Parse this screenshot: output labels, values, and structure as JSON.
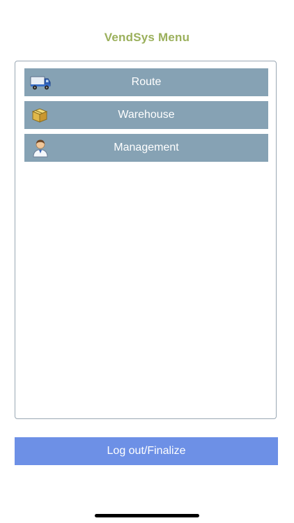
{
  "header": {
    "title": "VendSys Menu"
  },
  "menu": {
    "items": [
      {
        "label": "Route",
        "icon": "truck-icon"
      },
      {
        "label": "Warehouse",
        "icon": "box-icon"
      },
      {
        "label": "Management",
        "icon": "manager-person-icon"
      }
    ]
  },
  "footer": {
    "logout_label": "Log out/Finalize"
  },
  "colors": {
    "title": "#9bb05c",
    "menu_item_bg": "#86a2b4",
    "logout_bg": "#6d90e6",
    "panel_border": "#9aa8b4"
  }
}
